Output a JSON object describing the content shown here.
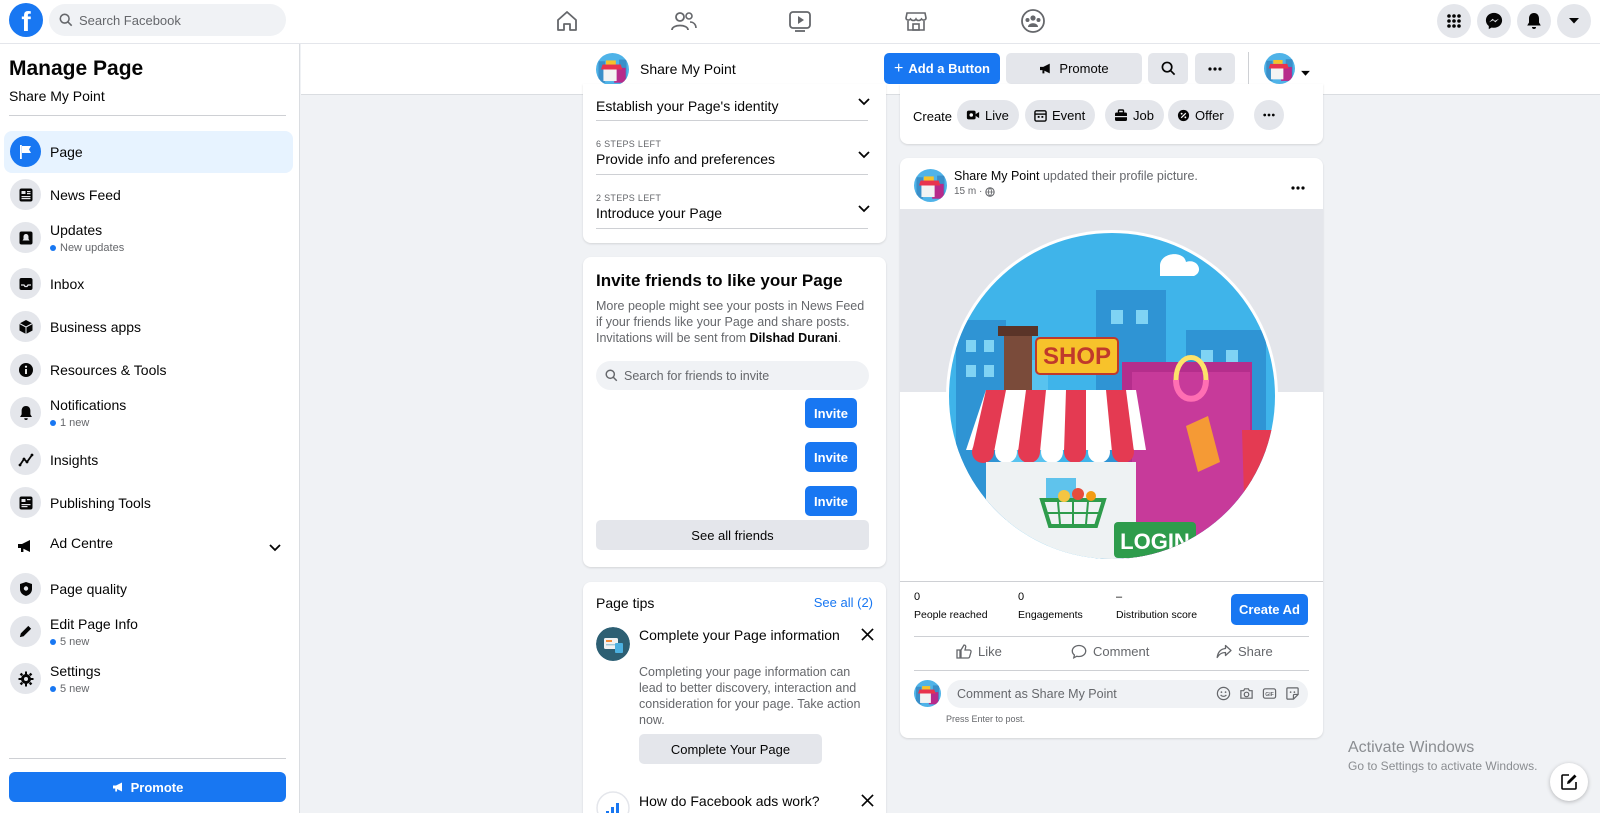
{
  "topbar": {
    "logo_letter": "f",
    "search_placeholder": "Search Facebook",
    "nav_icons": [
      "home-icon",
      "friends-icon",
      "watch-icon",
      "marketplace-icon",
      "groups-icon"
    ],
    "right_icons": [
      "menu-grid-icon",
      "messenger-icon",
      "notifications-icon",
      "account-dropdown-icon"
    ]
  },
  "sidebar": {
    "title": "Manage Page",
    "page_name": "Share My Point",
    "items": [
      {
        "label": "Page",
        "icon": "flag-icon",
        "sub": ""
      },
      {
        "label": "News Feed",
        "icon": "news-feed-icon",
        "sub": ""
      },
      {
        "label": "Updates",
        "icon": "updates-icon",
        "sub": "New updates"
      },
      {
        "label": "Inbox",
        "icon": "inbox-icon",
        "sub": ""
      },
      {
        "label": "Business apps",
        "icon": "cube-icon",
        "sub": ""
      },
      {
        "label": "Resources & Tools",
        "icon": "info-icon",
        "sub": ""
      },
      {
        "label": "Notifications",
        "icon": "bell-icon",
        "sub": "1 new"
      },
      {
        "label": "Insights",
        "icon": "insights-icon",
        "sub": ""
      },
      {
        "label": "Publishing Tools",
        "icon": "publishing-icon",
        "sub": ""
      },
      {
        "label": "Ad Centre",
        "icon": "megaphone-icon",
        "sub": ""
      },
      {
        "label": "Page quality",
        "icon": "shield-icon",
        "sub": ""
      },
      {
        "label": "Edit Page Info",
        "icon": "pencil-icon",
        "sub": "5 new"
      },
      {
        "label": "Settings",
        "icon": "gear-icon",
        "sub": "5 new"
      }
    ],
    "promote_label": "Promote"
  },
  "pagebar": {
    "page_name": "Share My Point",
    "add_button_label": "Add a Button",
    "promote_label": "Promote"
  },
  "setup": {
    "steps": [
      {
        "small": "",
        "title": "Establish your Page's identity"
      },
      {
        "small": "6 STEPS LEFT",
        "title": "Provide info and preferences"
      },
      {
        "small": "2 STEPS LEFT",
        "title": "Introduce your Page"
      }
    ]
  },
  "invite": {
    "title": "Invite friends to like your Page",
    "desc_pre": "More people might see your posts in News Feed if your friends like your Page and share posts. Invitations will be sent from ",
    "desc_name": "Dilshad Durani",
    "desc_post": ".",
    "search_placeholder": "Search for friends to invite",
    "invite_label": "Invite",
    "see_all_label": "See all friends"
  },
  "tips": {
    "title": "Page tips",
    "see_all": "See all (2)",
    "tip1_title": "Complete your Page information",
    "tip1_desc": "Completing your page information can lead to better discovery, interaction and consideration for your page. Take action now.",
    "tip1_button": "Complete Your Page",
    "tip2_title": "How do Facebook ads work?"
  },
  "create": {
    "label": "Create",
    "chips": [
      "Live",
      "Event",
      "Job",
      "Offer"
    ]
  },
  "post": {
    "author": "Share My Point",
    "action_text": " updated their profile picture.",
    "time": "15 m ·",
    "image_shop_text": "SHOP",
    "image_login_text": "LOGIN",
    "stats": [
      {
        "value": "0",
        "label": "People reached"
      },
      {
        "value": "0",
        "label": "Engagements"
      },
      {
        "value": "–",
        "label": "Distribution score"
      }
    ],
    "create_ad_label": "Create Ad",
    "like_label": "Like",
    "comment_label": "Comment",
    "share_label": "Share",
    "comment_placeholder": "Comment as Share My Point",
    "press_enter": "Press Enter to post."
  },
  "watermark": {
    "line1": "Activate Windows",
    "line2": "Go to Settings to activate Windows."
  },
  "colors": {
    "accent": "#1877f2",
    "background": "#f0f2f5"
  }
}
